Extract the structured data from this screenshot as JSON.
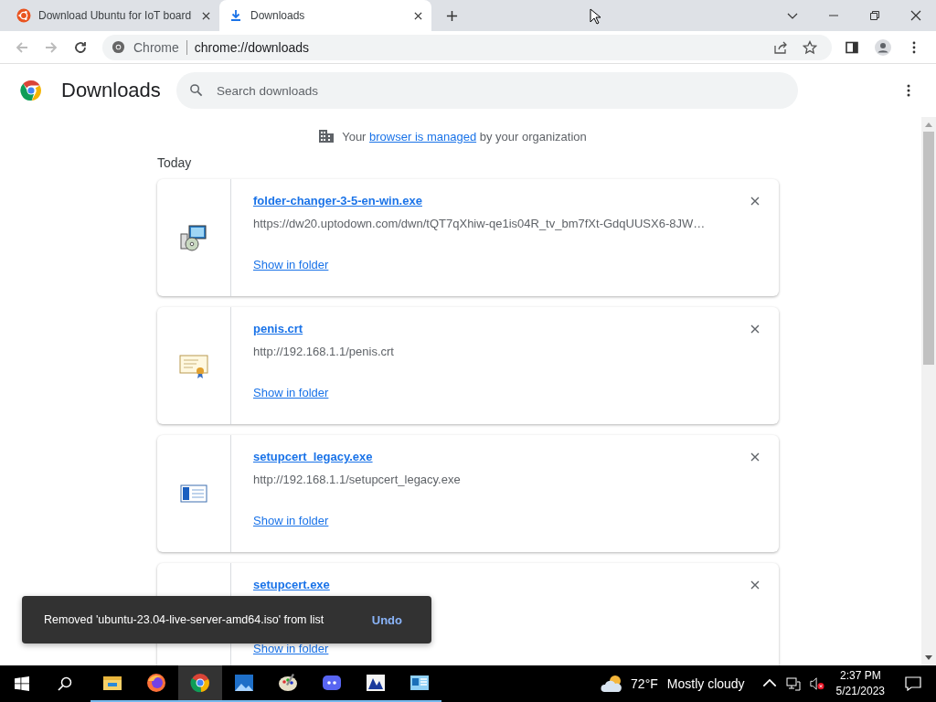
{
  "tabs": [
    {
      "title": "Download Ubuntu for IoT board",
      "kind": "ubuntu",
      "selected": false
    },
    {
      "title": "Downloads",
      "kind": "download",
      "selected": true
    }
  ],
  "omnibox": {
    "chip": "Chrome",
    "url": "chrome://downloads"
  },
  "page": {
    "title": "Downloads",
    "search": {
      "placeholder": "Search downloads"
    },
    "managed_notice": {
      "before": "Your",
      "link": "browser is managed",
      "after": "by your organization"
    },
    "date_heading": "Today",
    "downloads": [
      {
        "name": "folder-changer-3-5-en-win.exe",
        "url": "https://dw20.uptodown.com/dwn/tQT7qXhiw-qe1is04R_tv_bm7fXt-GdqUUSX6-8JW…",
        "action": "Show in folder",
        "kind": "installer"
      },
      {
        "name": "penis.crt",
        "url": "http://192.168.1.1/penis.crt",
        "action": "Show in folder",
        "kind": "certificate"
      },
      {
        "name": "setupcert_legacy.exe",
        "url": "http://192.168.1.1/setupcert_legacy.exe",
        "action": "Show in folder",
        "kind": "window"
      },
      {
        "name": "setupcert.exe",
        "action": "Show in folder",
        "kind": "hidden"
      }
    ]
  },
  "toast": {
    "message": "Removed 'ubuntu-23.04-live-server-amd64.iso' from list",
    "action": "Undo"
  },
  "taskbar": {
    "apps": [
      {
        "kind": "explorer",
        "selected": false
      },
      {
        "kind": "firefox",
        "selected": false
      },
      {
        "kind": "chrome",
        "selected": true
      },
      {
        "kind": "photos",
        "selected": false
      },
      {
        "kind": "paint",
        "selected": false
      },
      {
        "kind": "discord",
        "selected": false
      },
      {
        "kind": "viewer",
        "selected": false
      },
      {
        "kind": "control",
        "selected": false
      }
    ],
    "weather": {
      "temperature": "72°F",
      "condition": "Mostly cloudy"
    },
    "time": "2:37 PM",
    "date": "5/21/2023"
  }
}
